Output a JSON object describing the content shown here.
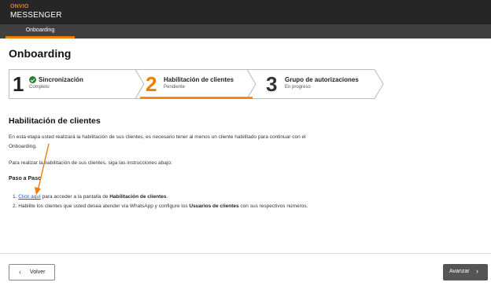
{
  "app": {
    "brand_top": "ONVIO",
    "brand_bottom": "MESSENGER"
  },
  "nav": {
    "tab_label": "Onboarding"
  },
  "page": {
    "title": "Onboarding"
  },
  "stepper": {
    "steps": [
      {
        "number": "1",
        "title": "Sincronización",
        "subtitle": "Completo",
        "status": "complete"
      },
      {
        "number": "2",
        "title": "Habilitación de clientes",
        "subtitle": "Pendiente",
        "status": "active"
      },
      {
        "number": "3",
        "title": "Grupo de autorizaciones",
        "subtitle": "En progreso",
        "status": "pending"
      }
    ]
  },
  "section": {
    "title": "Habilitación de clientes",
    "intro": "En esta etapa usted realizará la habilitación de sus clientes, es necesario tener al menos un cliente habilitado para continuar con el Onboarding.",
    "instructions": "Para realizar la habilitación de sus clientes, siga las instrucciones abajo:",
    "steps_heading": "Paso a Paso",
    "item1_num": "1.",
    "item1_link": "Click aquí",
    "item1_text": " para acceder a la pantalla de ",
    "item1_bold": "Habilitación de clientes",
    "item1_end": ".",
    "item2_num": "2.",
    "item2_text": "Habilite los clientes que usted desea atender vía WhatsApp y configure los ",
    "item2_bold": "Usuarios de clientes",
    "item2_end": " con sus respectivos números."
  },
  "footer": {
    "back_label": "Volver",
    "next_label": "Avanzar"
  },
  "colors": {
    "accent": "#f07c00",
    "topbar": "#262626",
    "navbar": "#404040",
    "success": "#2e7d32",
    "link": "#1a5fb4",
    "next_button": "#555555"
  }
}
